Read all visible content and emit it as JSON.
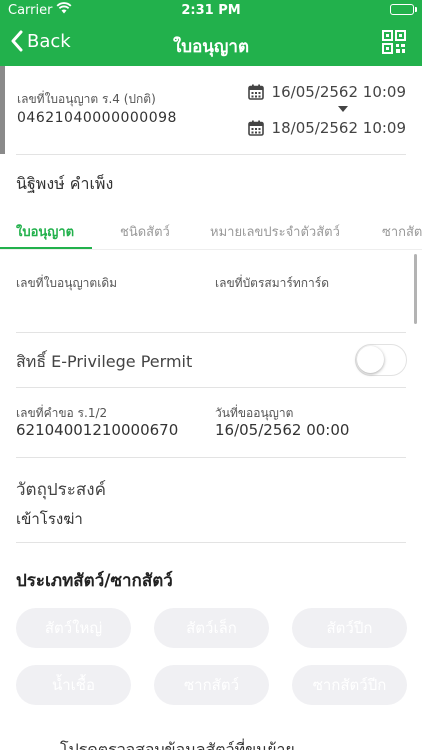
{
  "status_bar": {
    "carrier": "Carrier",
    "time": "2:31 PM"
  },
  "nav": {
    "back_label": "Back",
    "title": "ใบอนุญาต"
  },
  "permit": {
    "label": "เลขที่ใบอนุญาต ร.4 (ปกติ)",
    "number": "04621040000000098",
    "date_start": "16/05/2562 10:09",
    "date_end": "18/05/2562 10:09"
  },
  "owner": {
    "name": "นิฐิพงษ์ คำเพ็ง"
  },
  "tabs": [
    {
      "label": "ใบอนุญาต"
    },
    {
      "label": "ชนิดสัตว์"
    },
    {
      "label": "หมายเลขประจำตัวสัตว์"
    },
    {
      "label": "ซากสัตว์"
    }
  ],
  "fields": {
    "original_permit_label": "เลขที่ใบอนุญาตเดิม",
    "smart_card_label": "เลขที่บัตรสมาร์ทการ์ด",
    "eprivilege_label": "สิทธิ์ E-Privilege Permit",
    "eprivilege_enabled": false,
    "request_no_label": "เลขที่คำขอ ร.1/2",
    "request_no_value": "62104001210000670",
    "request_date_label": "วันที่ขออนุญาต",
    "request_date_value": "16/05/2562 00:00",
    "purpose_label": "วัตถุประสงค์",
    "purpose_value": "เข้าโรงฆ่า"
  },
  "animal_types": {
    "title": "ประเภทสัตว์/ซากสัตว์",
    "chips": [
      "สัตว์ใหญ่",
      "สัตว์เล็ก",
      "สัตว์ปีก",
      "น้ำเชื้อ",
      "ซากสัตว์",
      "ซากสัตว์ปีก"
    ]
  },
  "footer": {
    "partial_text": "โปรดตรวจสอบข้อมูลสัตว์ที่ขนย้าย"
  },
  "colors": {
    "brand": "#22b14c",
    "chip_bg": "#f0f0f3"
  }
}
